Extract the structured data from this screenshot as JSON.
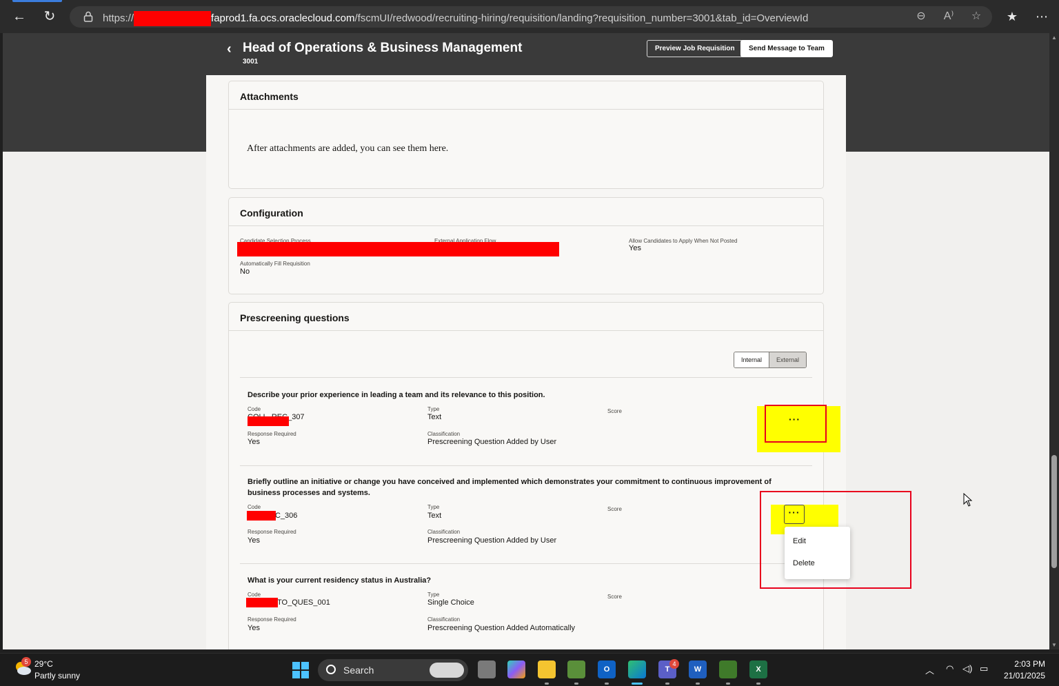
{
  "browser": {
    "url_prefix": "https://",
    "url_domain": "faprod1.fa.ocs.oraclecloud.com",
    "url_path": "/fscmUI/redwood/recruiting-hiring/requisition/landing?requisition_number=3001&tab_id=OverviewId",
    "back_icon": "←",
    "refresh_icon": "↻",
    "zoom_icon": "⊖",
    "read_aloud_icon": "A⁾",
    "favorite_icon": "☆",
    "favorites_icon": "★",
    "more_icon": "⋯"
  },
  "header": {
    "back_icon": "‹",
    "title": "Head of Operations & Business Management",
    "requisition_number": "3001",
    "preview_button": "Preview Job Requisition",
    "message_button": "Send Message to Team"
  },
  "attachments": {
    "title": "Attachments",
    "empty_text": "After attachments are added, you can see them here."
  },
  "configuration": {
    "title": "Configuration",
    "candidate_selection_label": "Candidate Selection Process",
    "external_flow_label": "External Application Flow",
    "allow_apply_label": "Allow Candidates to Apply When Not Posted",
    "allow_apply_value": "Yes",
    "auto_fill_label": "Automatically Fill Requisition",
    "auto_fill_value": "No"
  },
  "prescreening": {
    "title": "Prescreening questions",
    "toggle_internal": "Internal",
    "toggle_external": "External",
    "labels": {
      "code": "Code",
      "type": "Type",
      "score": "Score",
      "response_required": "Response Required",
      "classification": "Classification"
    },
    "questions": [
      {
        "title": "Describe your prior experience in leading a team and its relevance to this position.",
        "code": "COLL_REC_307",
        "type": "Text",
        "response_required": "Yes",
        "classification": "Prescreening Question Added by User"
      },
      {
        "title": "Briefly outline an initiative or change you have conceived and implemented which demonstrates your commitment to continuous improvement of business processes and systems.",
        "code": "C_306",
        "type": "Text",
        "response_required": "Yes",
        "classification": "Prescreening Question Added by User"
      },
      {
        "title": "What is your current residency status in Australia?",
        "code": "TO_QUES_001",
        "type": "Single Choice",
        "response_required": "Yes",
        "classification": "Prescreening Question Added Automatically"
      }
    ],
    "actions_label": "···",
    "menu": {
      "edit": "Edit",
      "delete": "Delete"
    }
  },
  "taskbar": {
    "weather_temp": "29°C",
    "weather_desc": "Partly sunny",
    "weather_badge": "5",
    "search_label": "Search",
    "teams_badge": "4",
    "time": "2:03 PM",
    "date": "21/01/2025"
  },
  "colors": {
    "highlight": "#ffff00",
    "annotation_red": "#e8001c",
    "header_dark": "#3a3a3a",
    "accent": "#4cc2ff"
  }
}
